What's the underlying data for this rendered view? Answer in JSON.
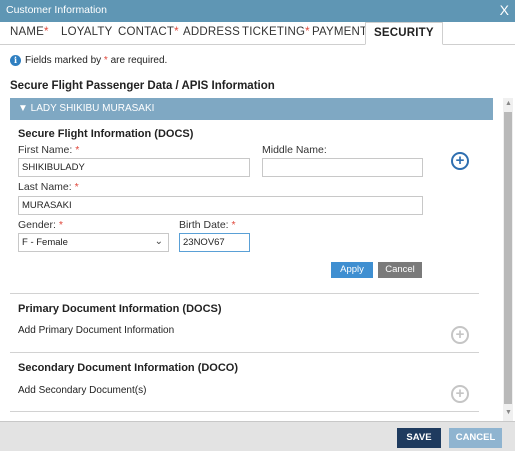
{
  "window": {
    "title": "Customer Information",
    "close_glyph": "X"
  },
  "tabs": [
    {
      "label": "NAME",
      "required": "*"
    },
    {
      "label": "LOYALTY",
      "required": ""
    },
    {
      "label": "CONTACT",
      "required": "*"
    },
    {
      "label": "ADDRESS",
      "required": ""
    },
    {
      "label": "TICKETING",
      "required": "*"
    },
    {
      "label": "PAYMENT",
      "required": ""
    },
    {
      "label": "SECURITY",
      "required": ""
    }
  ],
  "active_tab": "SECURITY",
  "notice": {
    "icon": "info-icon",
    "prefix": "Fields marked by",
    "marker": "*",
    "suffix": "are required."
  },
  "section_title": "Secure Flight Passenger Data / APIS Information",
  "passenger_header": "▼ LADY SHIKIBU MURASAKI",
  "docs": {
    "title": "Secure Flight Information (DOCS)",
    "first_name_label": "First Name:",
    "first_name_value": "SHIKIBULADY",
    "middle_name_label": "Middle Name:",
    "middle_name_value": "",
    "last_name_label": "Last Name:",
    "last_name_value": "MURASAKI",
    "gender_label": "Gender:",
    "gender_value": "F - Female",
    "birth_date_label": "Birth Date:",
    "birth_date_value": "23NOV67",
    "required_marker": "*",
    "add_icon": "plus-circle-icon",
    "apply_label": "Apply",
    "cancel_label": "Cancel"
  },
  "primary_doc": {
    "title": "Primary Document Information (DOCS)",
    "add_text": "Add Primary Document Information",
    "add_icon": "plus-circle-icon"
  },
  "secondary_doc": {
    "title": "Secondary Document Information (DOCO)",
    "add_text": "Add Secondary Document(s)",
    "add_icon": "plus-circle-icon"
  },
  "footer": {
    "save_label": "SAVE",
    "cancel_label": "CANCEL"
  },
  "colors": {
    "title_bar": "#5f96b4",
    "passenger_header": "#7fa8c3",
    "required": "#e0463a",
    "apply": "#3f8fd1",
    "save": "#1f3b5f",
    "footer_cancel": "#8fb4d0"
  }
}
